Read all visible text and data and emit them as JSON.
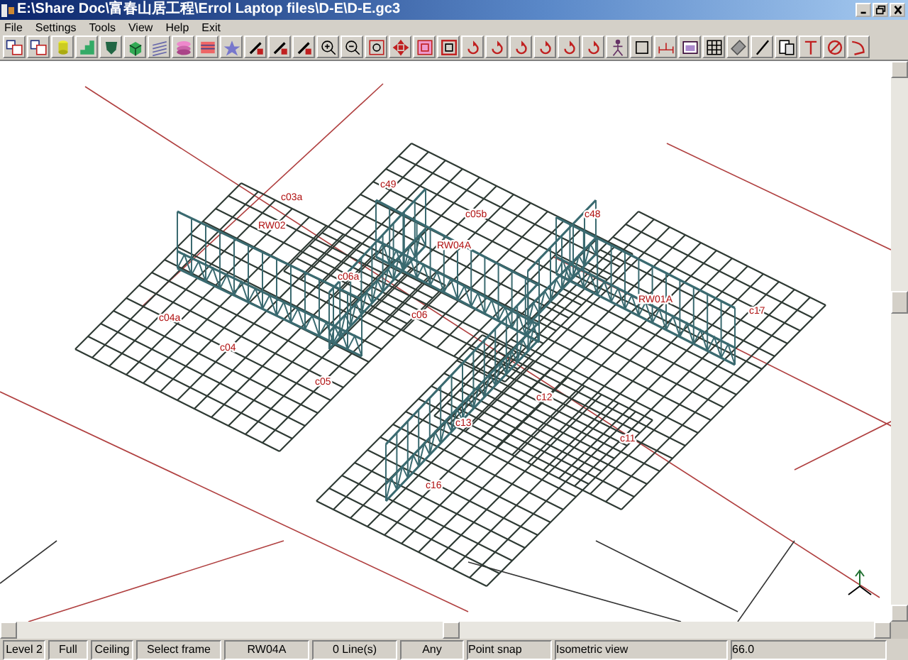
{
  "window": {
    "title": "E:\\Share Doc\\富春山居工程\\Errol Laptop files\\D-E\\D-E.gc3"
  },
  "menu": [
    "File",
    "Settings",
    "Tools",
    "View",
    "Help",
    "Exit"
  ],
  "drawing": {
    "labels": [
      "c03a",
      "RW02",
      "c49",
      "c04a",
      "c04",
      "c05",
      "c06a",
      "c06",
      "RW04A",
      "c05b",
      "c48",
      "RW01A",
      "c17",
      "c12",
      "c13",
      "c11",
      "c16"
    ]
  },
  "status_bar": [
    "Level 2",
    "Full",
    "Ceiling",
    "Select frame",
    "RW04A",
    "0 Line(s)",
    "Any",
    "Point snap",
    "Isometric view",
    "66.0"
  ]
}
